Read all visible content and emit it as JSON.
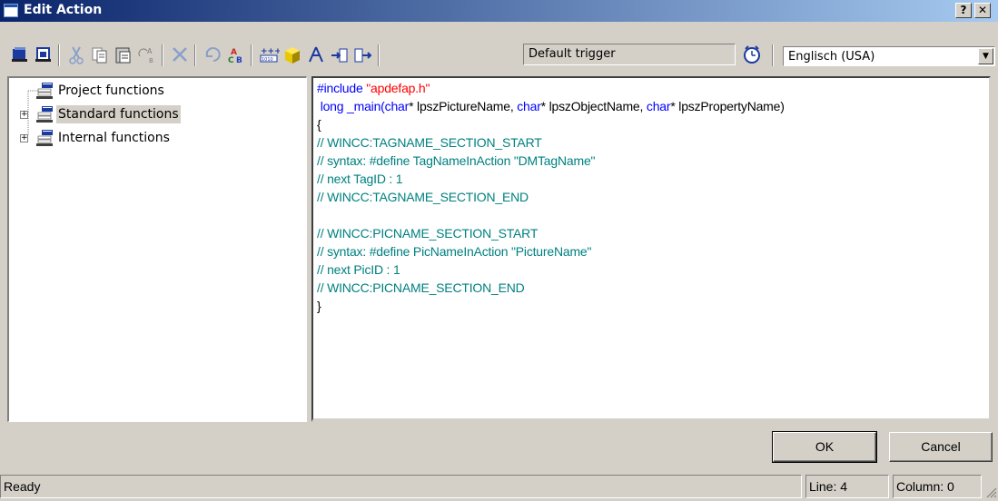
{
  "window": {
    "title": "Edit Action",
    "help_label": "?",
    "close_label": "✕"
  },
  "toolbar": {
    "trigger_label": "Default trigger",
    "language": "Englisch (USA)",
    "icons": [
      "compile-icon",
      "compile-all-icon",
      "cut-icon",
      "copy-icon",
      "paste-icon",
      "replace-icon",
      "delete-icon",
      "undo-icon",
      "spell-check-icon",
      "tag-icon",
      "object-icon",
      "picture-icon",
      "import-icon",
      "export-icon",
      "clock-icon"
    ]
  },
  "tree": {
    "items": [
      {
        "label": "Project functions",
        "expandable": false,
        "selected": false
      },
      {
        "label": "Standard functions",
        "expandable": true,
        "selected": true
      },
      {
        "label": "Internal functions",
        "expandable": true,
        "selected": false
      }
    ]
  },
  "editor": {
    "include_directive": "#include",
    "include_file": "\"apdefap.h\"",
    "main_prefix": " long _main(",
    "char_kw": "char",
    "param1": "* lpszPictureName, ",
    "param2": "* lpszObjectName, ",
    "param3": "* lpszPropertyName)",
    "open_brace": "{",
    "tag_start": "// WINCC:TAGNAME_SECTION_START",
    "tag_syntax": "// syntax: #define TagNameInAction \"DMTagName\"",
    "tag_next": "// next TagID : 1",
    "tag_end": "// WINCC:TAGNAME_SECTION_END",
    "pic_start": "// WINCC:PICNAME_SECTION_START",
    "pic_syntax": "// syntax: #define PicNameInAction \"PictureName\"",
    "pic_next": "// next PicID : 1",
    "pic_end": "// WINCC:PICNAME_SECTION_END",
    "close_brace": "}",
    "colors": {
      "keyword": "#0000ff",
      "string": "#ff0000",
      "comment": "#008080"
    }
  },
  "buttons": {
    "ok": "OK",
    "cancel": "Cancel"
  },
  "statusbar": {
    "message": "Ready",
    "line": "Line: 4",
    "column": "Column: 0"
  }
}
